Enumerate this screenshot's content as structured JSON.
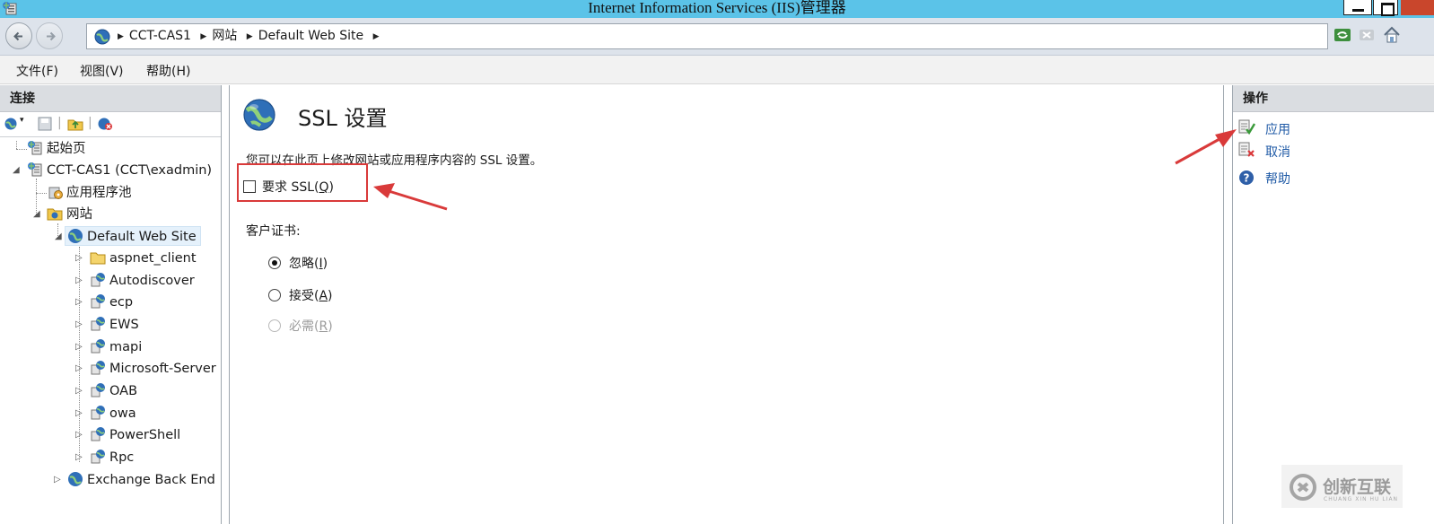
{
  "window": {
    "title": "Internet Information Services (IIS)管理器"
  },
  "address_bar": {
    "crumbs": [
      "CCT-CAS1",
      "网站",
      "Default Web Site"
    ]
  },
  "menu": {
    "items": [
      "文件(F)",
      "视图(V)",
      "帮助(H)"
    ]
  },
  "connections": {
    "header": "连接",
    "tree": {
      "start_page": "起始页",
      "server": "CCT-CAS1 (CCT\\exadmin)",
      "app_pools": "应用程序池",
      "sites": "网站",
      "default_site": "Default Web Site",
      "children": [
        "aspnet_client",
        "Autodiscover",
        "ecp",
        "EWS",
        "mapi",
        "Microsoft-Server",
        "OAB",
        "owa",
        "PowerShell",
        "Rpc"
      ],
      "backend_site": "Exchange Back End"
    }
  },
  "main": {
    "title": "SSL 设置",
    "description": "您可以在此页上修改网站或应用程序内容的 SSL 设置。",
    "require_ssl": {
      "text": "要求 SSL(",
      "key": "Q",
      "tail": ")",
      "checked": false
    },
    "client_cert_label": "客户证书:",
    "client_cert_options": [
      {
        "text": "忽略(",
        "key": "I",
        "tail": ")",
        "selected": true,
        "enabled": true
      },
      {
        "text": "接受(",
        "key": "A",
        "tail": ")",
        "selected": false,
        "enabled": true
      },
      {
        "text": "必需(",
        "key": "R",
        "tail": ")",
        "selected": false,
        "enabled": false
      }
    ]
  },
  "actions": {
    "header": "操作",
    "apply": "应用",
    "cancel": "取消",
    "help": "帮助"
  },
  "watermark": {
    "text": "创新互联",
    "sub": "CHUANG XIN HU LIAN"
  },
  "colors": {
    "titlebar": "#5bc3e8",
    "link": "#1f5aa6",
    "annotation_red": "#d93a3a"
  }
}
